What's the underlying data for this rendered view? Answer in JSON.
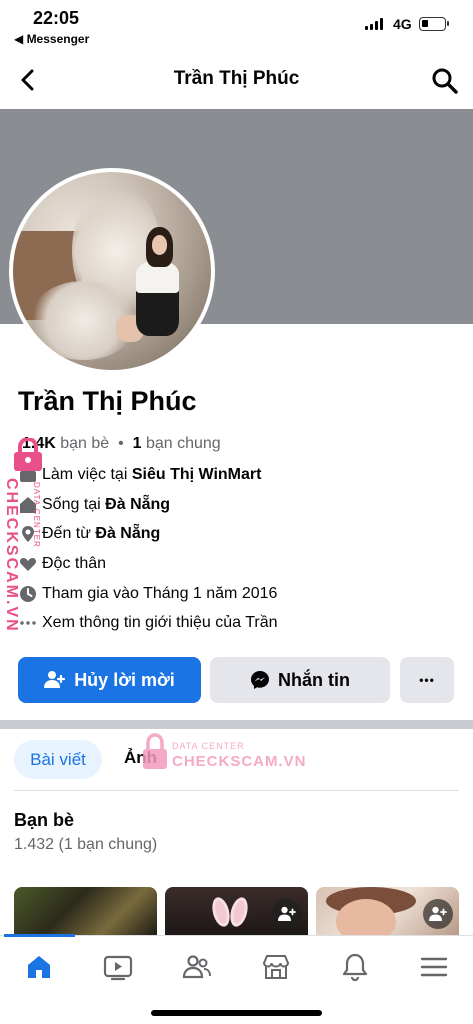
{
  "status_bar": {
    "time": "22:05",
    "back_app": "◀ Messenger",
    "network": "4G",
    "battery_level": 0.3
  },
  "header": {
    "title": "Trần Thị Phúc"
  },
  "profile": {
    "name": "Trần Thị Phúc",
    "friends_count": "1.4K",
    "friends_label": "bạn bè",
    "mutual_count": "1",
    "mutual_label": "bạn chung",
    "info": {
      "work_prefix": "Làm việc tại",
      "work_place": "Siêu Thị WinMart",
      "live_prefix": "Sống tại",
      "live_place": "Đà Nẵng",
      "from_prefix": "Đến từ",
      "from_place": "Đà Nẵng",
      "relationship": "Độc thân",
      "joined": "Tham gia vào Tháng 1 năm 2016",
      "see_about": "Xem thông tin giới thiệu của Trần"
    }
  },
  "actions": {
    "primary": "Hủy lời mời",
    "message": "Nhắn tin",
    "more": "•••"
  },
  "tabs": {
    "posts": "Bài viết",
    "photos": "Ảnh"
  },
  "friends_section": {
    "title": "Bạn bè",
    "subtitle": "1.432 (1 bạn chung)"
  },
  "watermark": {
    "small": "DATA CENTER",
    "big": "CHECKSCAM.VN"
  },
  "colors": {
    "accent": "#1b74e4",
    "cover": "#8a8d91",
    "secondary_button": "#e4e6eb",
    "watermark": "#e8508a"
  }
}
